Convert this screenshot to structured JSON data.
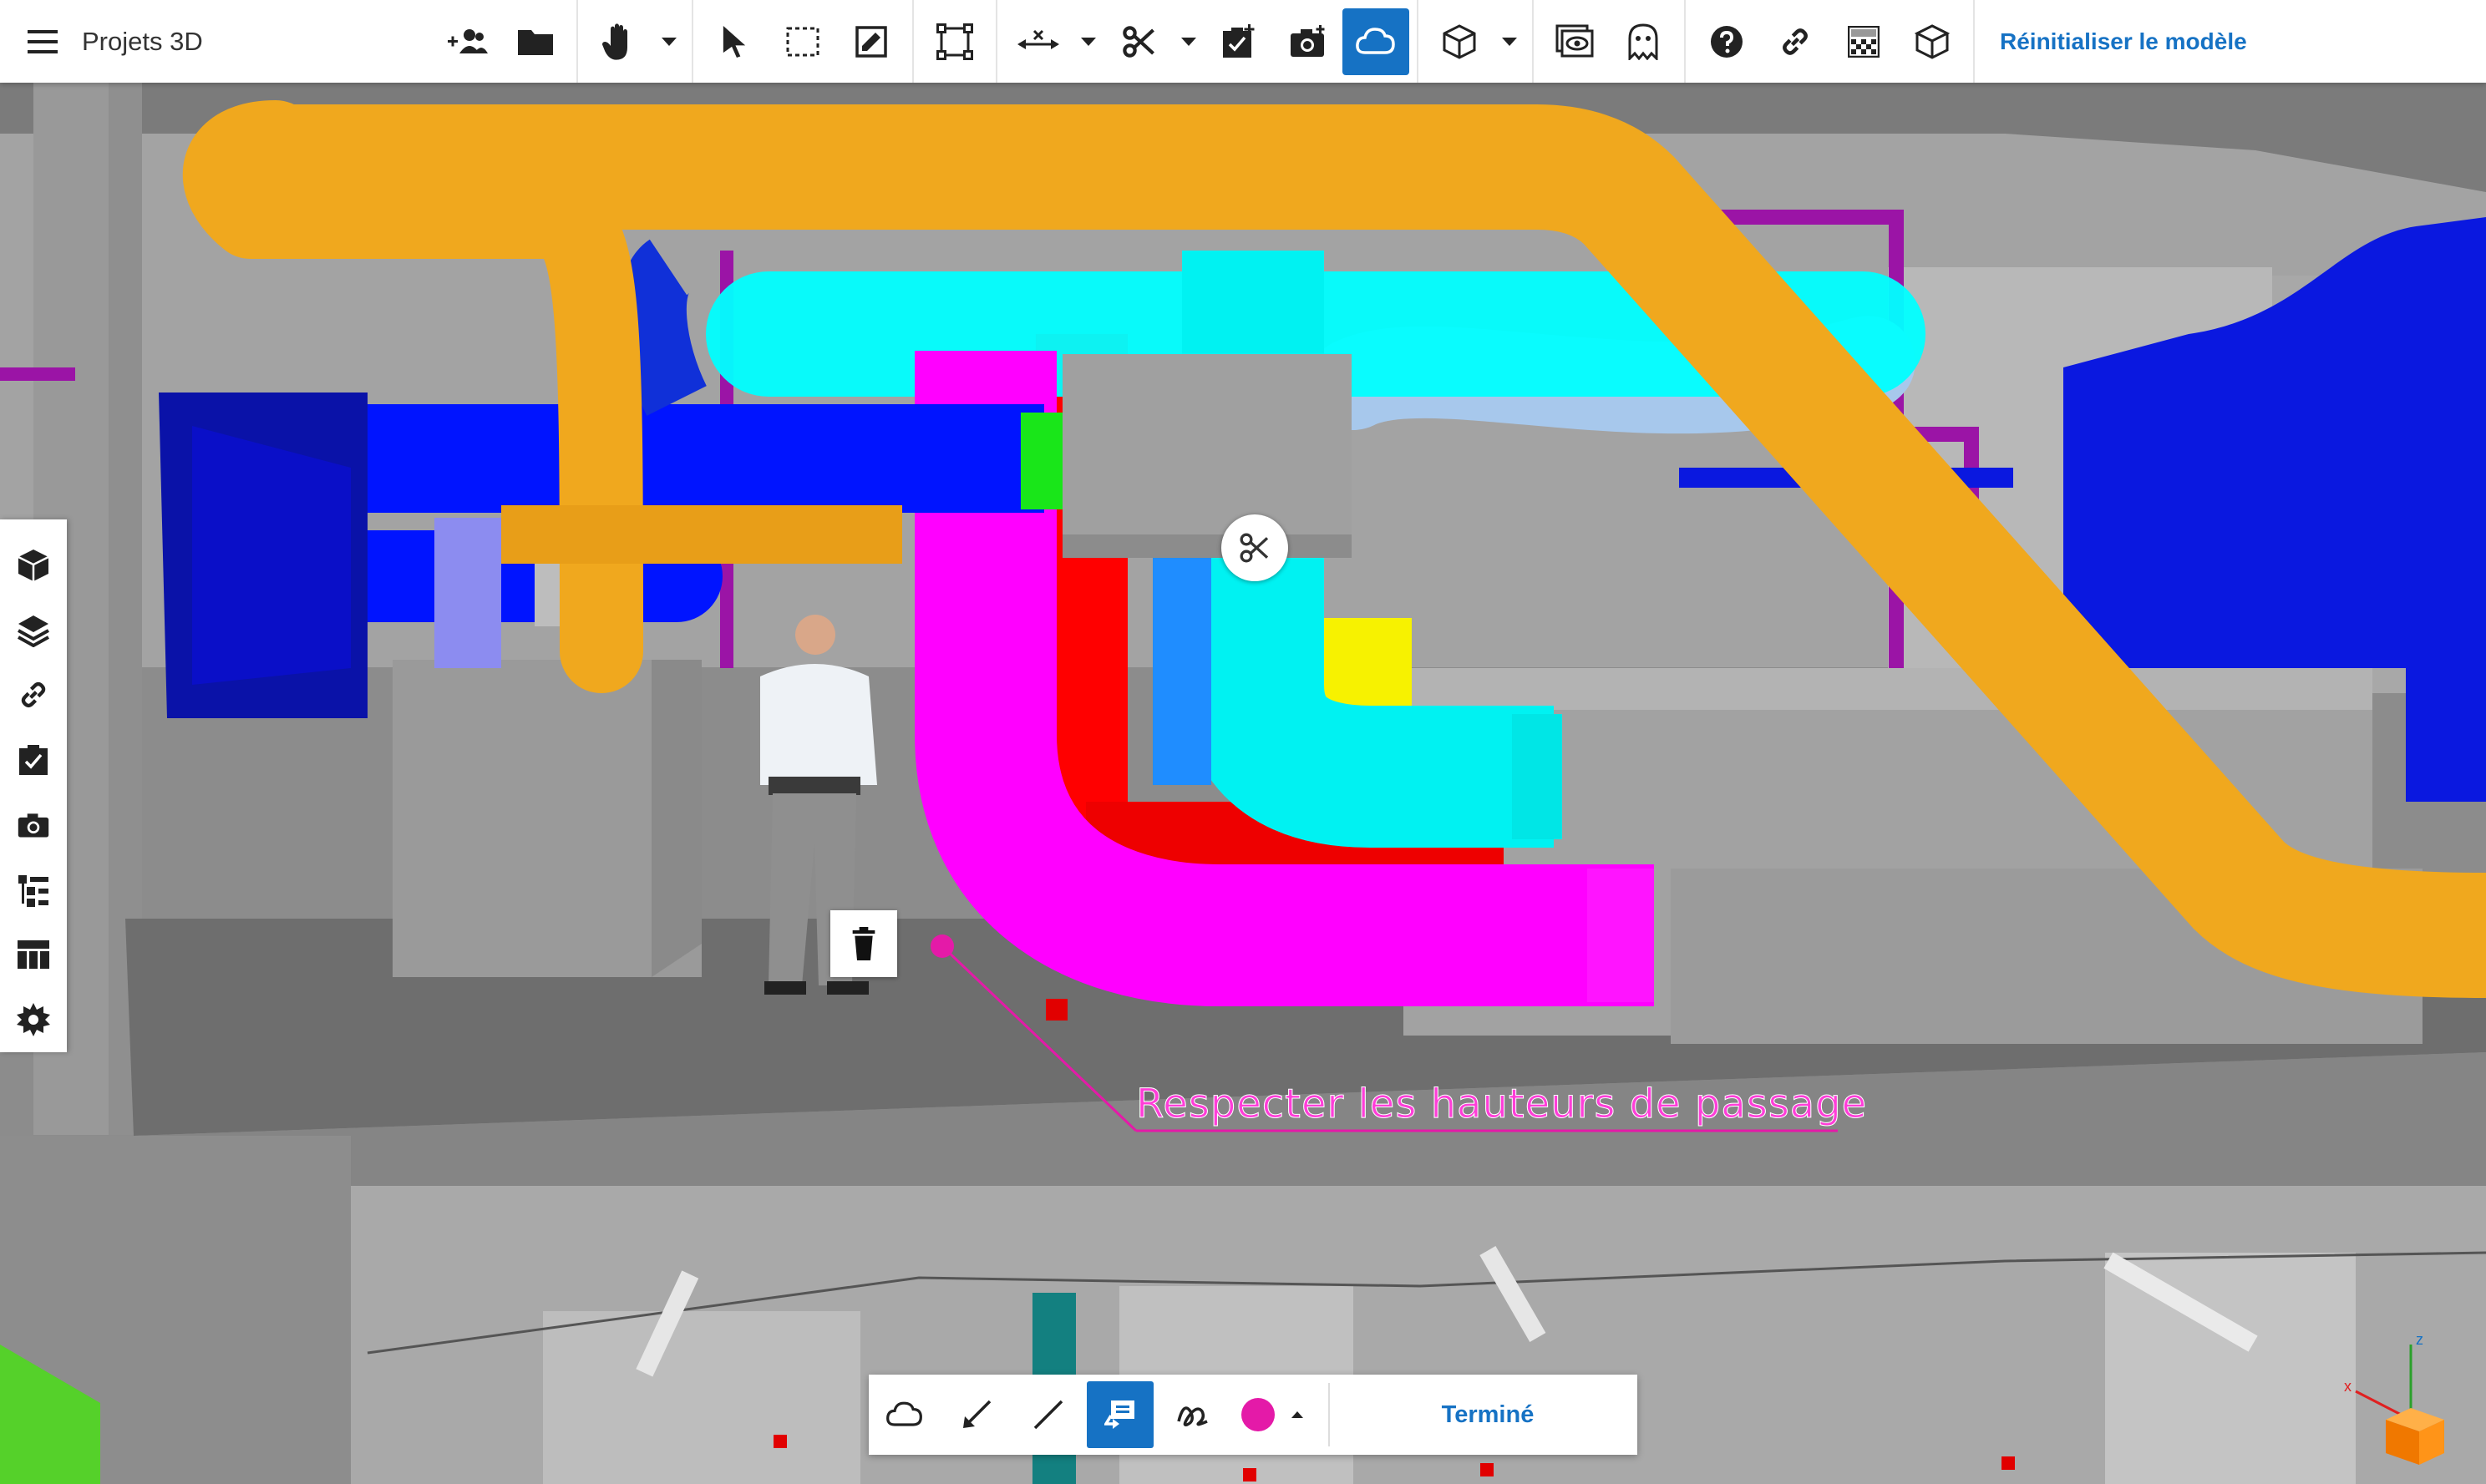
{
  "toolbar": {
    "app_title": "Projets 3D",
    "reset_label": "Réinitialiser le modèle",
    "icons": [
      "menu-icon",
      "add-user-icon",
      "folder-icon",
      "hand-icon",
      "select-icon",
      "box-select-icon",
      "edit-icon",
      "fit-icon",
      "measure-icon",
      "cut-icon",
      "checklist-icon",
      "camera-icon",
      "cloud-icon",
      "cube-icon",
      "view-icon",
      "ghost-icon",
      "help-icon",
      "link-icon",
      "grid-icon",
      "model-icon"
    ]
  },
  "sidebar": {
    "items": [
      "cube-icon",
      "layers-icon",
      "link-icon",
      "checklist-icon",
      "camera-icon",
      "tree-icon",
      "table-icon",
      "settings-icon"
    ]
  },
  "annotation": {
    "text": "Respecter les hauteurs de passage",
    "color": "#ff3dd8"
  },
  "draw_toolbar": {
    "done_label": "Terminé",
    "active_color": "#e41aa8"
  },
  "axes": {
    "x": "x",
    "z": "z"
  },
  "colors": {
    "accent": "#1672c4"
  }
}
